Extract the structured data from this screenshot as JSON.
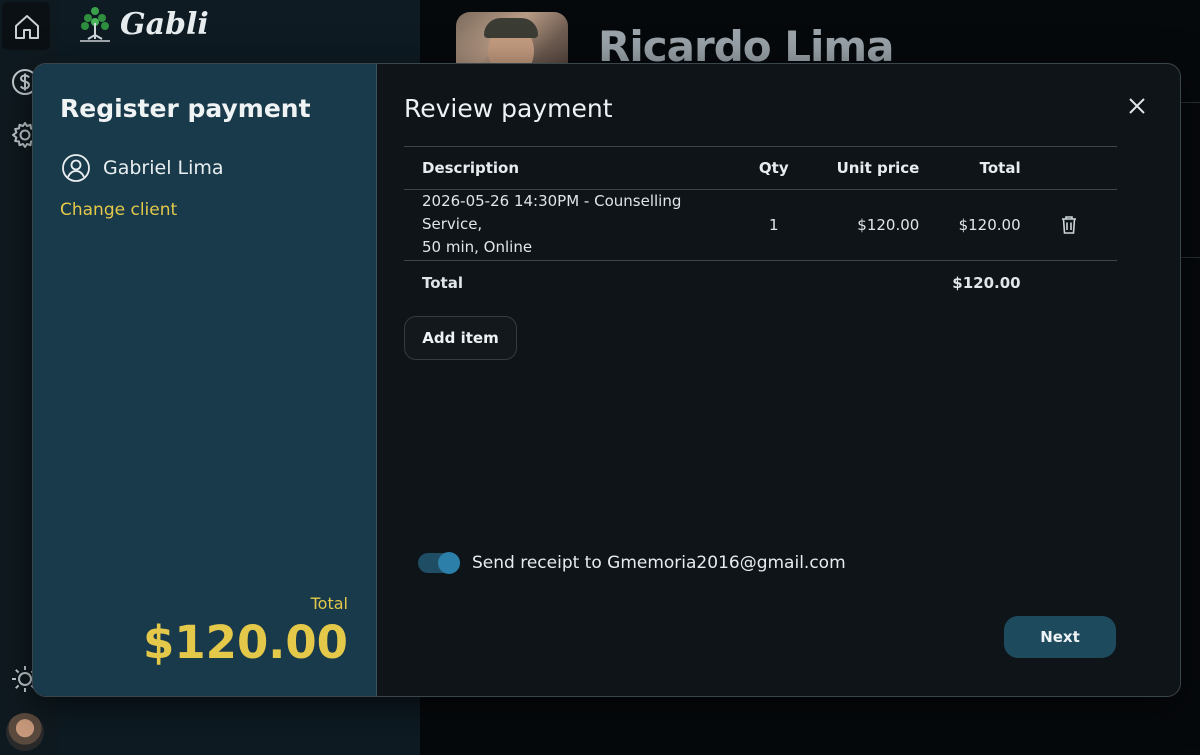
{
  "app": {
    "logo_text": "Gabli"
  },
  "profile": {
    "name": "Ricardo Lima"
  },
  "modal": {
    "left": {
      "title": "Register payment",
      "client_name": "Gabriel Lima",
      "change_client_label": "Change client",
      "total_label": "Total",
      "total_value": "$120.00"
    },
    "right": {
      "title": "Review payment",
      "table": {
        "headers": {
          "description": "Description",
          "qty": "Qty",
          "unit_price": "Unit price",
          "total": "Total"
        },
        "rows": [
          {
            "description_line1": "2026-05-26 14:30PM - Counselling Service,",
            "description_line2": "50 min, Online",
            "qty": "1",
            "unit_price": "$120.00",
            "total": "$120.00"
          }
        ],
        "total_label": "Total",
        "total_value": "$120.00"
      },
      "add_item_label": "Add item",
      "receipt_label": "Send receipt to Gmemoria2016@gmail.com",
      "receipt_enabled": true,
      "next_label": "Next"
    }
  },
  "colors": {
    "accent_yellow": "#e4c84a",
    "panel_teal": "#193a4a",
    "button_teal": "#1e4a5e",
    "toggle_blue": "#2b7fa8"
  },
  "icons": [
    "home-icon",
    "dollar-icon",
    "gear-icon",
    "sun-icon",
    "tree-logo-icon",
    "user-circle-icon",
    "close-icon",
    "trash-icon"
  ]
}
